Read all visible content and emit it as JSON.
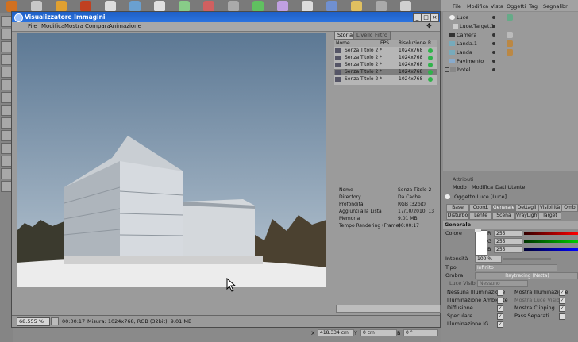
{
  "viewer": {
    "title": "Visualizzatore Immagini",
    "menu": [
      "File",
      "Modifica",
      "Mostra",
      "Compara",
      "Animazione"
    ],
    "tabs": [
      "Storia",
      "Livello",
      "Filtro"
    ],
    "history_headers": {
      "name": "Nome",
      "fps": "FPS",
      "res": "Risoluzione",
      "r": "R"
    },
    "history": [
      {
        "name": "Senza Titolo 2 *",
        "res": "1024x768"
      },
      {
        "name": "Senza Titolo 2 *",
        "res": "1024x768"
      },
      {
        "name": "Senza Titolo 2 *",
        "res": "1024x768"
      },
      {
        "name": "Senza Titolo 2 *",
        "res": "1024x768"
      },
      {
        "name": "Senza Titolo 2 *",
        "res": "1024x768"
      }
    ],
    "info": [
      {
        "k": "Nome",
        "v": "Senza Titolo 2"
      },
      {
        "k": "Directory",
        "v": "Da Cache"
      },
      {
        "k": "Profondità",
        "v": "RGB (32bit)"
      },
      {
        "k": "Aggiunti alla Lista",
        "v": "17/10/2010, 13"
      },
      {
        "k": "Memoria",
        "v": "9.01 MB"
      },
      {
        "k": "Tempo Rendering (Frame)",
        "v": "00:00:17"
      }
    ],
    "status": {
      "zoom": "68.555 %",
      "time": "00:00:17",
      "size": "Misura: 1024x768, RGB (32bit), 9.01 MB"
    }
  },
  "objects": {
    "menu": [
      "File",
      "Modifica",
      "Vista",
      "Oggetti",
      "Tag",
      "Segnalibri"
    ],
    "items": [
      {
        "name": "Luce",
        "indent": 0
      },
      {
        "name": "Luce.Target.1",
        "indent": 1
      },
      {
        "name": "Camera",
        "indent": 0
      },
      {
        "name": "Landa.1",
        "indent": 0
      },
      {
        "name": "Landa",
        "indent": 0
      },
      {
        "name": "Pavimento",
        "indent": 0
      },
      {
        "name": "hotel",
        "indent": 0
      }
    ]
  },
  "attributes": {
    "header": "Attributi",
    "menu": [
      "Modo",
      "Modifica",
      "Dati Utente"
    ],
    "object": "Oggetto Luce [Luce]",
    "tabs_row1": [
      "Base",
      "Coord.",
      "Generale",
      "Dettagli",
      "Visibilità",
      "Omb"
    ],
    "tabs_row2": [
      "Disturbo",
      "Lente",
      "Scena",
      "VrayLight",
      "Target"
    ],
    "active_tab": "Generale",
    "section": "Generale",
    "color_label": "Colore",
    "rgb": [
      {
        "ch": "R",
        "v": "255"
      },
      {
        "ch": "G",
        "v": "255"
      },
      {
        "ch": "B",
        "v": "255"
      }
    ],
    "intensity_label": "Intensità",
    "intensity": "100 %",
    "type_label": "Tipo",
    "type": "Infinito",
    "shadow_label": "Ombra",
    "shadow": "Raytracing (Netta)",
    "visible_light_label": "Luce Visibile",
    "visible_light": "Nessuno",
    "checks_left": [
      {
        "label": "Nessuna Illuminazione",
        "on": false
      },
      {
        "label": "Illuminazione Ambiente",
        "on": false
      },
      {
        "label": "Diffusione",
        "on": true
      },
      {
        "label": "Speculare",
        "on": true
      },
      {
        "label": "Illuminazione IG",
        "on": true
      }
    ],
    "checks_right": [
      {
        "label": "Mostra Illuminazione",
        "on": true
      },
      {
        "label": "Mostra Luce Visibile",
        "on": true
      },
      {
        "label": "Mostra Clipping",
        "on": true
      },
      {
        "label": "Pass Separati",
        "on": false
      }
    ]
  },
  "coords": {
    "x": "418.334 cm",
    "y": "0 cm",
    "b": "0 °"
  },
  "colors": {
    "titlebar": "#1f5fc5",
    "sky_top": "#5c7894",
    "sky_bottom": "#b8c6d2",
    "status_green": "#2fb34a"
  }
}
